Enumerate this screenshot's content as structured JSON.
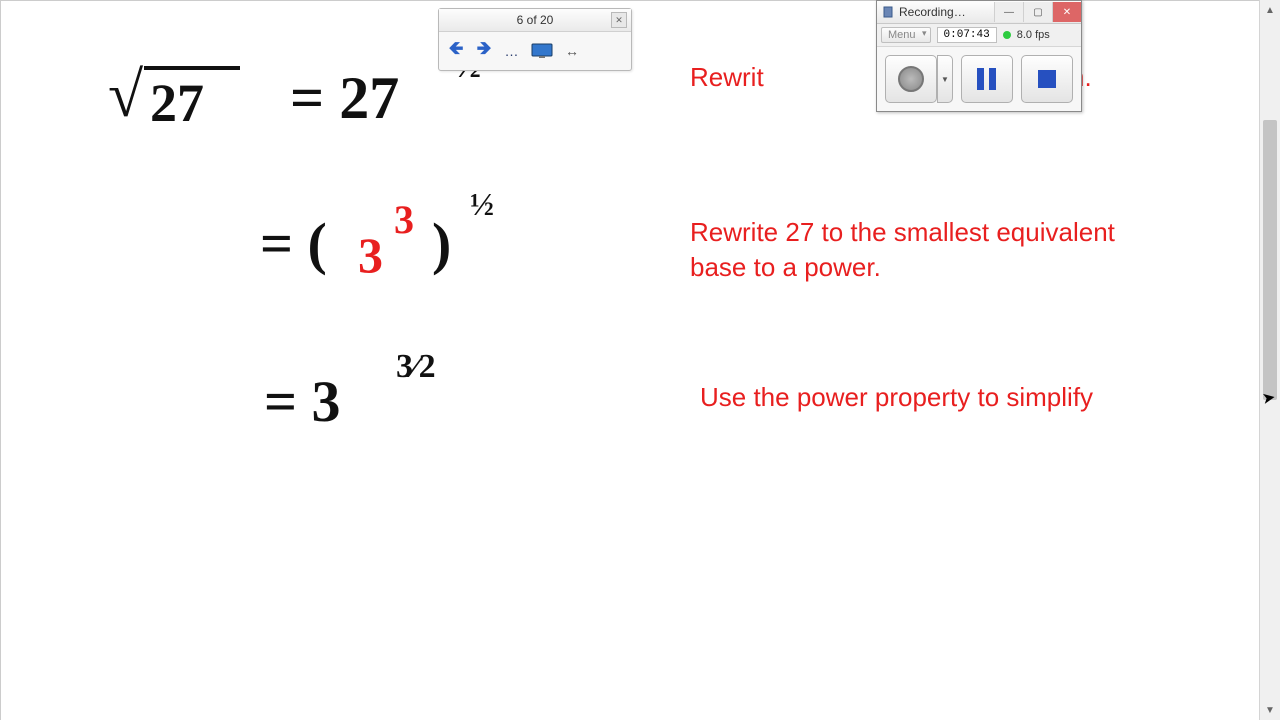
{
  "ink_toolbar": {
    "page_indicator": "6 of 20",
    "close_glyph": "✕",
    "prev_glyph": "🡸",
    "next_glyph": "🡺",
    "dots_glyph": "…",
    "swap_glyph": "↔"
  },
  "recorder": {
    "title": "Recording…",
    "min_glyph": "—",
    "max_glyph": "▢",
    "close_glyph": "✕",
    "menu_label": "Menu",
    "timer": "0:07:43",
    "fps": "8.0 fps"
  },
  "instructions": {
    "line1a": "Rewrit",
    "line1b": "tial form.",
    "line2": "Rewrite 27 to the smallest equivalent base to a power.",
    "line3": "Use the power property to simplify"
  },
  "math": {
    "radicand": "27",
    "eq1_a": "= 27",
    "eq1_exp": "½",
    "eq2_a": "= (",
    "eq2_base": "3",
    "eq2_innerexp": "3",
    "eq2_b": ")",
    "eq2_outerexp": "½",
    "eq3_a": "= 3",
    "eq3_exp": "3⁄2"
  },
  "cursor_glyph": "➤"
}
